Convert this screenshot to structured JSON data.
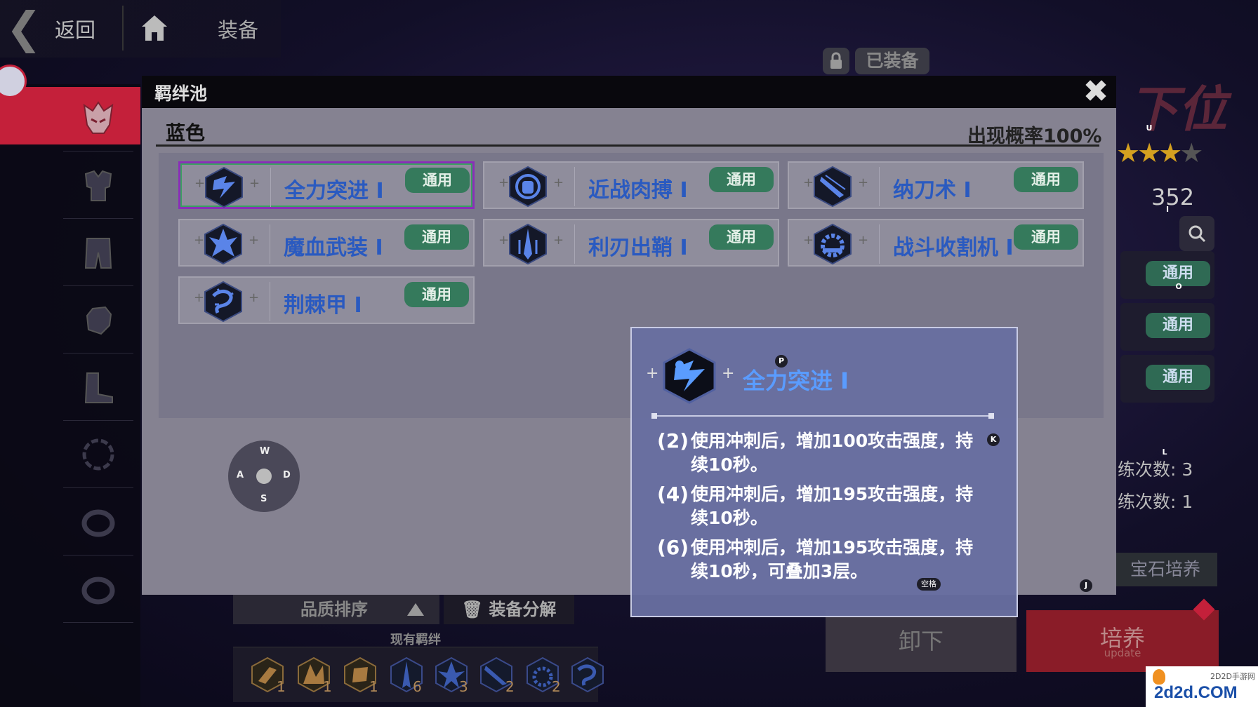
{
  "topbar": {
    "back_label": "返回",
    "title": "装备"
  },
  "equipped_badge": "已装备",
  "right_panel": {
    "title": "下位",
    "stars_filled": 3,
    "stars_total": 4,
    "score": "352",
    "tags": [
      "通用",
      "通用",
      "通用"
    ],
    "train_count_1": "练次数: 3",
    "train_count_2": "练次数: 1",
    "gem_button": "宝石培养",
    "unequip_button": "卸下",
    "cultivate_button": "培养",
    "cultivate_sub": "update"
  },
  "bottom": {
    "sort_label": "品质排序",
    "dismantle_label": "装备分解",
    "current_bonds_label": "现有羁绊",
    "strip_counts": [
      "1",
      "1",
      "1",
      "6",
      "3",
      "2",
      "2"
    ]
  },
  "modal": {
    "title": "羁绊池",
    "tier": "蓝色",
    "probability": "出现概率100%",
    "cards": [
      {
        "name": "全力突进 Ⅰ",
        "tag": "通用",
        "icon": "dash-icon",
        "selected": true
      },
      {
        "name": "近战肉搏 Ⅰ",
        "tag": "通用",
        "icon": "fist-icon"
      },
      {
        "name": "纳刀术 Ⅰ",
        "tag": "通用",
        "icon": "sheath-icon"
      },
      {
        "name": "魔血武装 Ⅰ",
        "tag": "通用",
        "icon": "demon-blood-icon"
      },
      {
        "name": "利刃出鞘 Ⅰ",
        "tag": "通用",
        "icon": "blade-icon"
      },
      {
        "name": "战斗收割机 Ⅰ",
        "tag": "通用",
        "icon": "harvester-icon"
      },
      {
        "name": "荆棘甲 Ⅰ",
        "tag": "通用",
        "icon": "thorns-icon"
      }
    ],
    "close_icon": "close-icon"
  },
  "joystick": {
    "up": "W",
    "left": "A",
    "right": "D",
    "down": "S"
  },
  "detail": {
    "name": "全力突进 Ⅰ",
    "key_hint_icon": "P",
    "key_hint_right": "K",
    "entries": [
      {
        "num": "(2)",
        "text": "使用冲刺后，增加100攻击强度，持续10秒。"
      },
      {
        "num": "(4)",
        "text": "使用冲刺后，增加195攻击强度，持续10秒。"
      },
      {
        "num": "(6)",
        "text": "使用冲刺后，增加195攻击强度，持续10秒，可叠加3层。"
      }
    ],
    "space_hint": "空格"
  },
  "hints": {
    "u": "U",
    "i": "I",
    "o": "O",
    "l": "L",
    "j": "J"
  },
  "watermark": {
    "text": "2d2d.COM",
    "small": "2D2D手游网"
  },
  "colors": {
    "accent_red": "#c4203a",
    "tag_green": "#357a5c",
    "bond_blue": "#2a5ac0",
    "select_purple": "#8a2fb8"
  }
}
